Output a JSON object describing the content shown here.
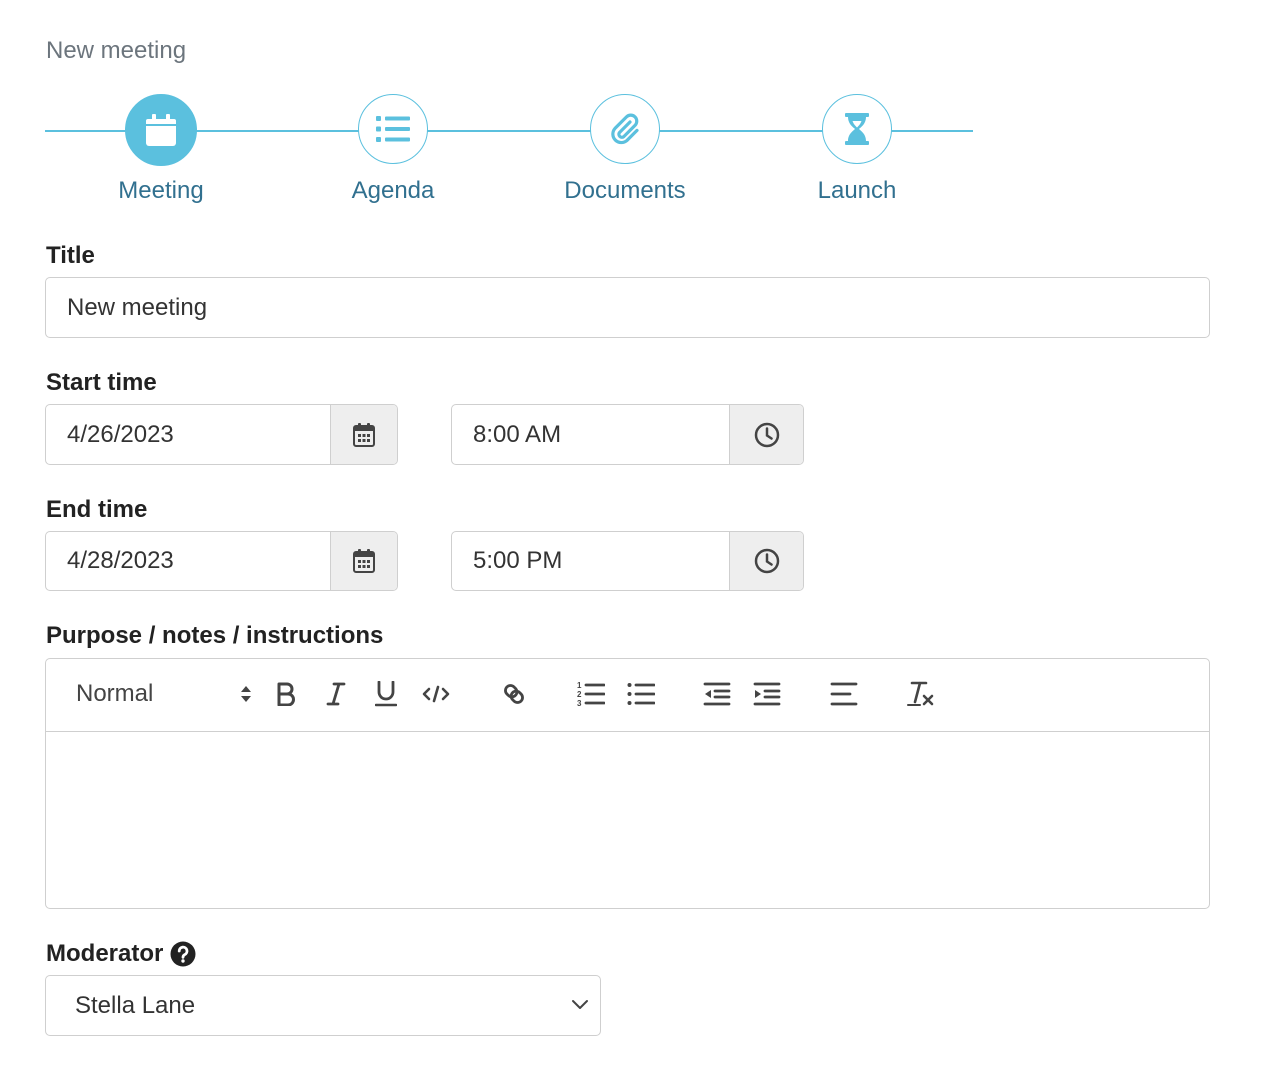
{
  "page": {
    "heading": "New meeting"
  },
  "stepper": {
    "accent": "#5bc0de",
    "steps": [
      {
        "label": "Meeting",
        "icon": "calendar-icon",
        "active": true
      },
      {
        "label": "Agenda",
        "icon": "list-icon",
        "active": false
      },
      {
        "label": "Documents",
        "icon": "paperclip-icon",
        "active": false
      },
      {
        "label": "Launch",
        "icon": "hourglass-icon",
        "active": false
      }
    ]
  },
  "form": {
    "title": {
      "label": "Title",
      "value": "New meeting"
    },
    "start_time": {
      "label": "Start time",
      "date": "4/26/2023",
      "time": "8:00 AM"
    },
    "end_time": {
      "label": "End time",
      "date": "4/28/2023",
      "time": "5:00 PM"
    },
    "notes": {
      "label": "Purpose / notes / instructions",
      "format": "Normal",
      "toolbar": [
        "bold-icon",
        "italic-icon",
        "underline-icon",
        "code-icon",
        "link-icon",
        "ordered-list-icon",
        "bullet-list-icon",
        "outdent-icon",
        "indent-icon",
        "align-icon",
        "clear-format-icon"
      ]
    },
    "moderator": {
      "label": "Moderator",
      "help_icon": "question-circle-icon",
      "value": "Stella Lane"
    }
  }
}
